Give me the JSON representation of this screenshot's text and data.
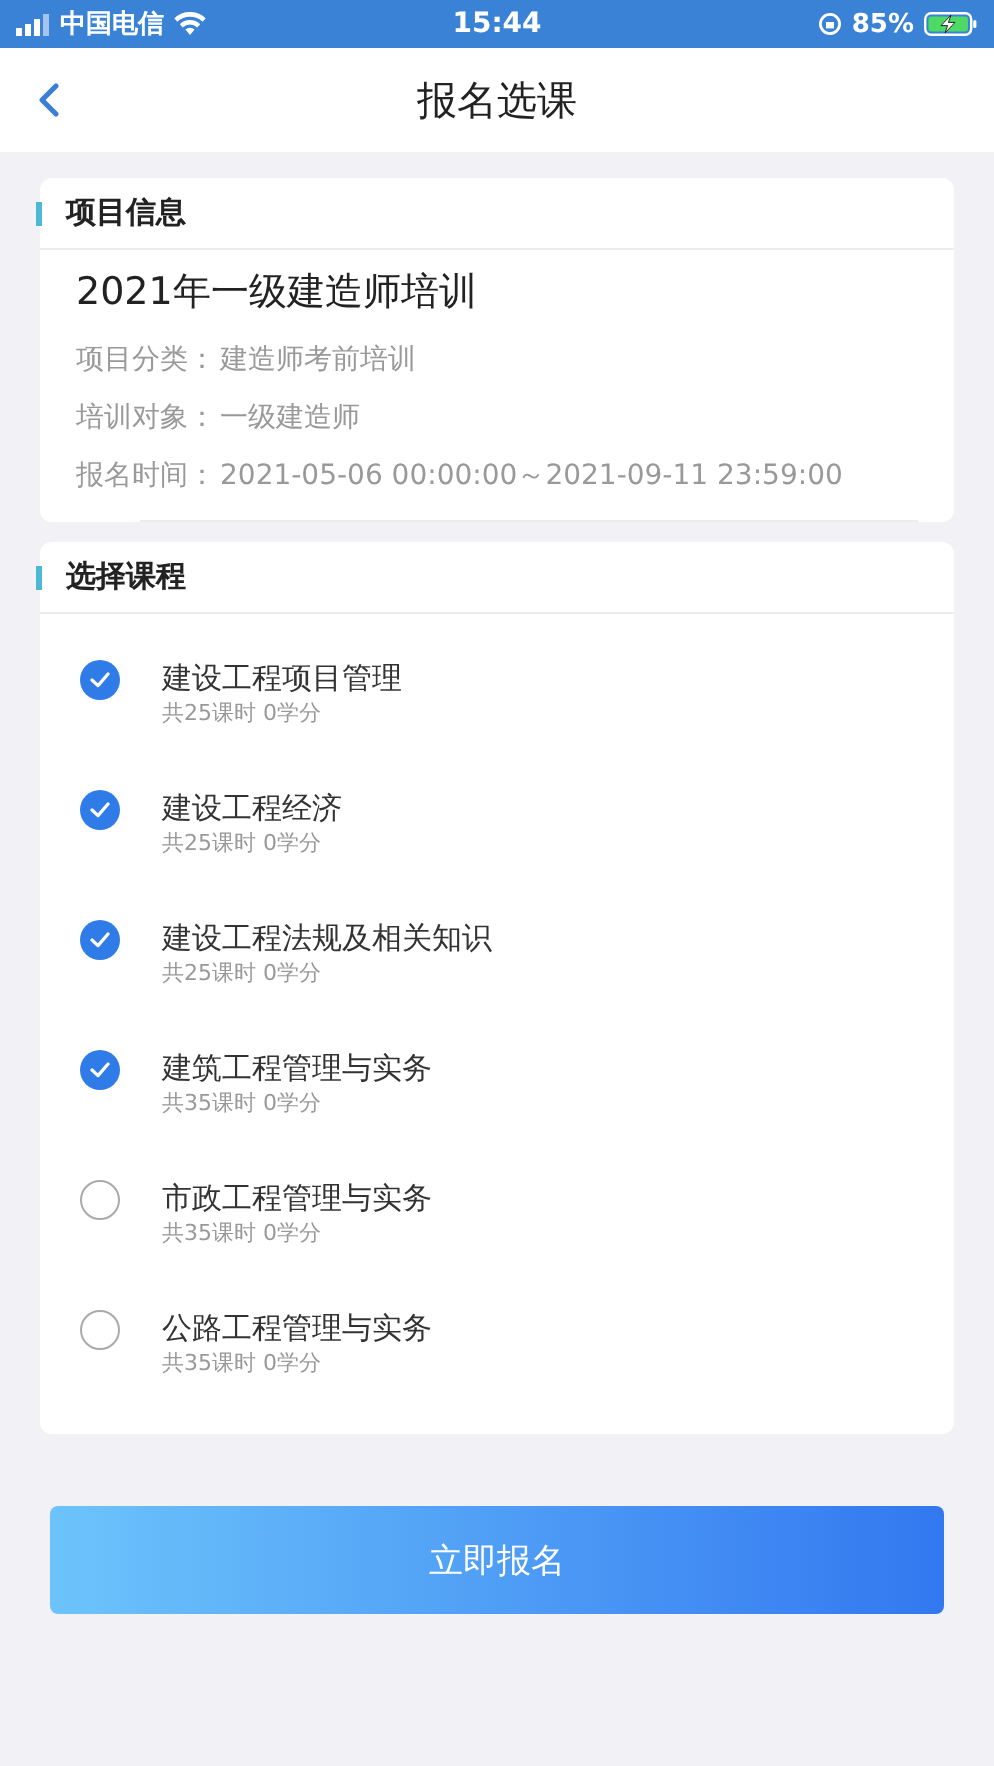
{
  "status_bar": {
    "carrier": "中国电信",
    "time": "15:44",
    "battery": "85%"
  },
  "nav": {
    "title": "报名选课"
  },
  "project_info": {
    "heading": "项目信息",
    "name": "2021年一级建造师培训",
    "fields": [
      {
        "label": "项目分类：",
        "value": "建造师考前培训"
      },
      {
        "label": "培训对象：",
        "value": "一级建造师"
      },
      {
        "label": "报名时间：",
        "value": "2021-05-06 00:00:00～2021-09-11 23:59:00"
      }
    ]
  },
  "courses": {
    "heading": "选择课程",
    "items": [
      {
        "name": "建设工程项目管理",
        "meta": "共25课时 0学分",
        "checked": true
      },
      {
        "name": "建设工程经济",
        "meta": "共25课时 0学分",
        "checked": true
      },
      {
        "name": "建设工程法规及相关知识",
        "meta": "共25课时 0学分",
        "checked": true
      },
      {
        "name": "建筑工程管理与实务",
        "meta": "共35课时 0学分",
        "checked": true
      },
      {
        "name": "市政工程管理与实务",
        "meta": "共35课时 0学分",
        "checked": false
      },
      {
        "name": "公路工程管理与实务",
        "meta": "共35课时 0学分",
        "checked": false
      }
    ]
  },
  "submit_button": "立即报名"
}
